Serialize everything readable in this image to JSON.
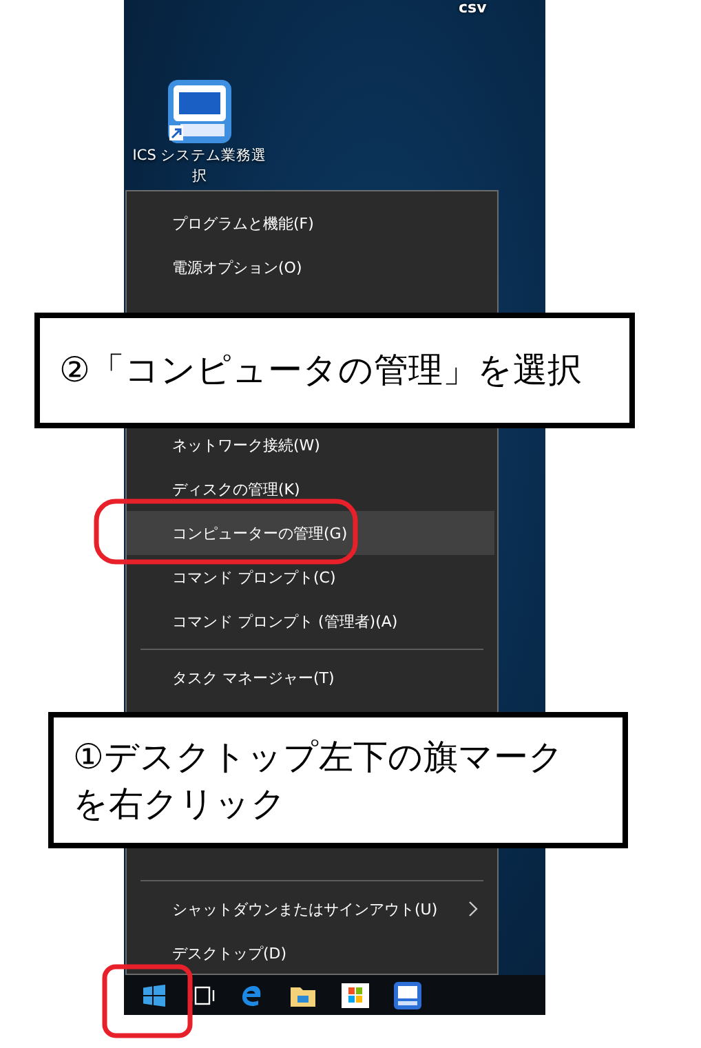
{
  "desktop": {
    "top_label": "csv",
    "shortcut": {
      "label": "ICS システム業務選択"
    }
  },
  "context_menu": {
    "groups": [
      {
        "separator_before": false,
        "items": [
          {
            "label": "プログラムと機能(F)",
            "selected": false,
            "submenu": false
          },
          {
            "label": "電源オプション(O)",
            "selected": false,
            "submenu": false
          }
        ]
      },
      {
        "separator_before": false,
        "items": [
          {
            "label": "ネットワーク接続(W)",
            "selected": false,
            "submenu": false
          },
          {
            "label": "ディスクの管理(K)",
            "selected": false,
            "submenu": false
          },
          {
            "label": "コンピューターの管理(G)",
            "selected": true,
            "submenu": false
          },
          {
            "label": "コマンド プロンプト(C)",
            "selected": false,
            "submenu": false
          },
          {
            "label": "コマンド プロンプト (管理者)(A)",
            "selected": false,
            "submenu": false
          }
        ]
      },
      {
        "separator_before": true,
        "items": [
          {
            "label": "タスク マネージャー(T)",
            "selected": false,
            "submenu": false
          }
        ]
      },
      {
        "separator_before": true,
        "items": [
          {
            "label": "シャットダウンまたはサインアウト(U)",
            "selected": false,
            "submenu": true
          },
          {
            "label": "デスクトップ(D)",
            "selected": false,
            "submenu": false
          }
        ]
      }
    ]
  },
  "taskbar": {
    "icons": [
      {
        "kind": "start"
      },
      {
        "kind": "taskview"
      },
      {
        "kind": "browser"
      },
      {
        "kind": "folder"
      },
      {
        "kind": "store"
      },
      {
        "kind": "app"
      }
    ]
  },
  "callouts": [
    {
      "text": "②「コンピュータの管理」を選択"
    },
    {
      "text": "①デスクトップ左下の旗マークを右クリック"
    }
  ]
}
